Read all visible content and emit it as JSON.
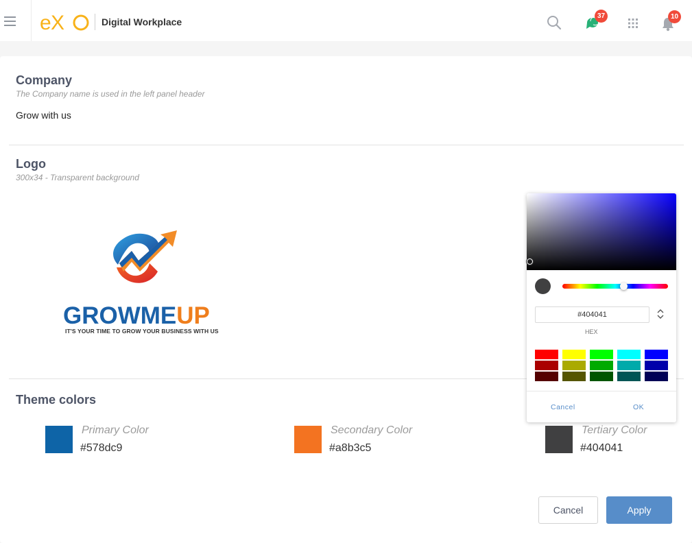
{
  "header": {
    "brand_logo_text": "eXo",
    "brand_title": "Digital Workplace",
    "chat_badge": "37",
    "notification_badge": "10"
  },
  "company": {
    "title": "Company",
    "subtitle": "The Company name is used in the left panel header",
    "value": "Grow with us"
  },
  "logo": {
    "title": "Logo",
    "subtitle": "300x34 - Transparent background",
    "image_text_part1": "GROW",
    "image_text_part2": "ME",
    "image_text_part3": "UP",
    "image_tagline": "IT'S YOUR TIME TO GROW YOUR BUSINESS WITH US"
  },
  "theme_colors": {
    "title": "Theme colors",
    "items": [
      {
        "label": "Primary Color",
        "value": "#578dc9",
        "swatch": "#0e64a7"
      },
      {
        "label": "Secondary Color",
        "value": "#a8b3c5",
        "swatch": "#f37321"
      },
      {
        "label": "Tertiary Color",
        "value": "#404041",
        "swatch": "#404041"
      }
    ]
  },
  "color_picker": {
    "hex_value": "#404041",
    "hex_label": "HEX",
    "preview_color": "#404041",
    "presets": [
      "#ff0000",
      "#ffff00",
      "#00ff00",
      "#00ffff",
      "#0000ff",
      "#aa0000",
      "#aaaa00",
      "#00aa00",
      "#00aaaa",
      "#0000aa",
      "#550000",
      "#555500",
      "#005500",
      "#005555",
      "#000055"
    ],
    "cancel_label": "Cancel",
    "ok_label": "OK"
  },
  "actions": {
    "cancel_label": "Cancel",
    "apply_label": "Apply"
  }
}
